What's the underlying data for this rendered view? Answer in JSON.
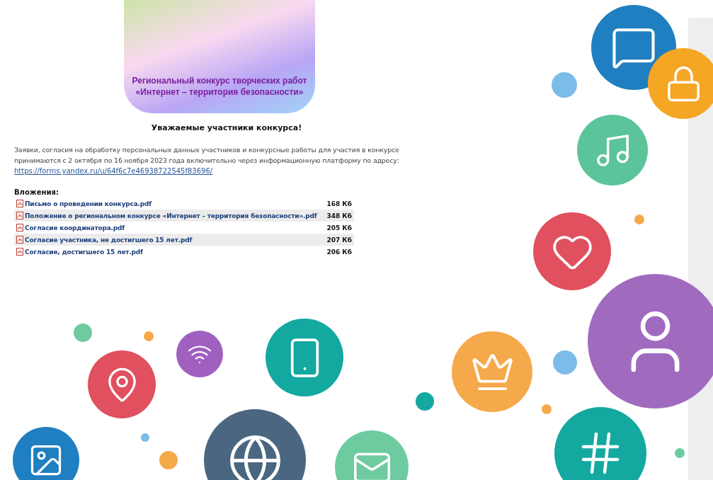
{
  "banner": {
    "lines": [
      "Региональный конкурс творческих работ",
      "«Интернет – территория безопасности»"
    ]
  },
  "heading": "Уважаемые участники конкурса!",
  "notice": {
    "text": "Заявки, согласия на обработку персональных данных участников и конкурсные работы для участия в конкурсе принимаются с 2 октября по 16 ноября 2023 года включительно через информационную платформу по адресу:",
    "link": "https://forms.yandex.ru/u/64f6c7e46938722545f83696/"
  },
  "attachments": {
    "title": "Вложения:",
    "files": [
      {
        "name": "Письмо о проведении конкурса.pdf",
        "size": "168 Кб"
      },
      {
        "name": "Положение о региональном конкурсе «Интернет – территория безопасности».pdf",
        "size": "348 Кб"
      },
      {
        "name": "Согласие координатора.pdf",
        "size": "205 Кб"
      },
      {
        "name": "Согласие участника, не достигшего 15 лет.pdf",
        "size": "207 Кб"
      },
      {
        "name": "Согласие, достигшего 15 лет.pdf",
        "size": "206 Кб"
      }
    ]
  }
}
